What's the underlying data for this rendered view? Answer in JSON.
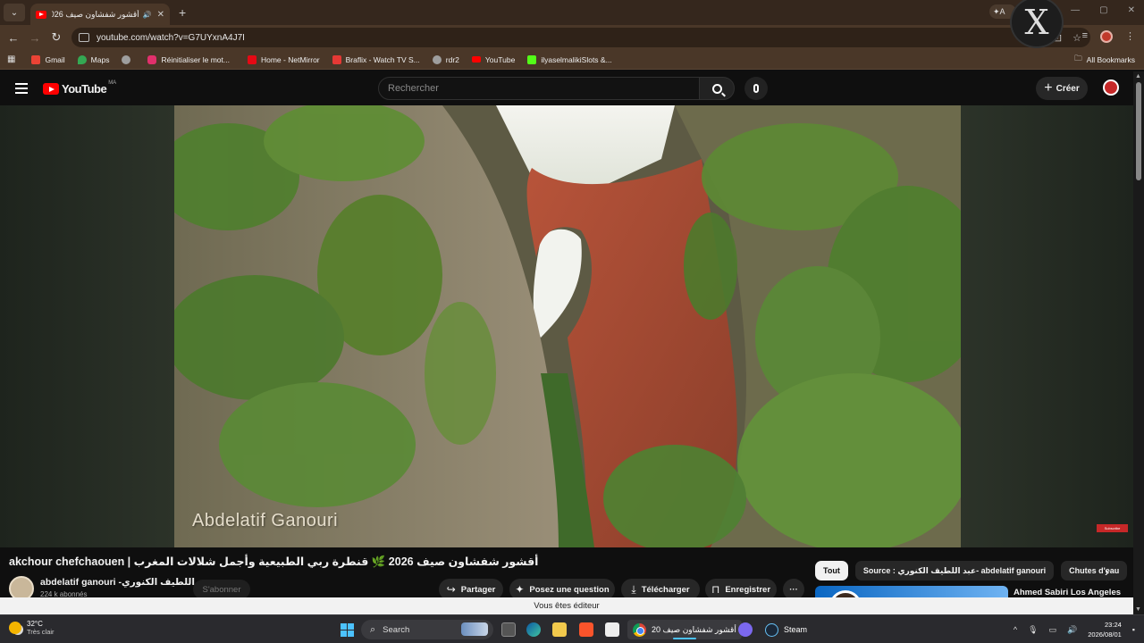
{
  "browser": {
    "tab_title": "أقشور شفشاون صيف 2026 ؛",
    "url": "youtube.com/watch?v=G7UYxnA4J7I",
    "ai_chip_label": "A",
    "bookmarks": [
      {
        "label": "Gmail",
        "color": "#ea4335"
      },
      {
        "label": "Maps",
        "color": "#34a853"
      },
      {
        "label": "",
        "color": "#9e9e9e"
      },
      {
        "label": "Réinitialiser le mot...",
        "color": "#e1306c"
      },
      {
        "label": "Home - NetMirror",
        "color": "#e50914"
      },
      {
        "label": "Braflix - Watch TV S...",
        "color": "#e53935"
      },
      {
        "label": "rdr2",
        "color": "#9e9e9e"
      },
      {
        "label": "YouTube",
        "color": "#ff0000"
      },
      {
        "label": "ilyaselmalikiSlots &...",
        "color": "#53fc18"
      }
    ],
    "all_bookmarks": "All Bookmarks"
  },
  "youtube": {
    "logo_text": "YouTube",
    "country_code": "MA",
    "search_placeholder": "Rechercher",
    "create_label": "Créer",
    "video_watermark": "Abdelatif Ganouri",
    "subscribe_badge": "Subscribe",
    "video_title": "akchour chefchaouen | أقشور شفشاون صيف 2026 🌿 قنطرة ربي الطبيعية وأجمل شلالات المغرب",
    "channel_name": "abdelatif ganouri -عبد اللطيف الكنوري",
    "subscribers": "224 k abonnés",
    "subscribe_label": "S'abonner",
    "actions": {
      "share": "Partager",
      "ask": "Posez une question",
      "download": "Télécharger",
      "save": "Enregistrer",
      "more": "···"
    },
    "chips": [
      "Tout",
      "Source : عبد اللطيف الكنوري- abdelatif ganouri",
      "Chutes d'eau"
    ],
    "rec_title": "Ahmed Sabiri Los Angeles",
    "editor_notice": "Vous êtes éditeur"
  },
  "taskbar": {
    "temperature": "32°C",
    "weather_text": "Très clair",
    "search_label": "Search",
    "chrome_app_title": "أقشور شفشاون صيف 20",
    "steam_label": "Steam",
    "time": "23:24",
    "date": "2026/08/01"
  }
}
